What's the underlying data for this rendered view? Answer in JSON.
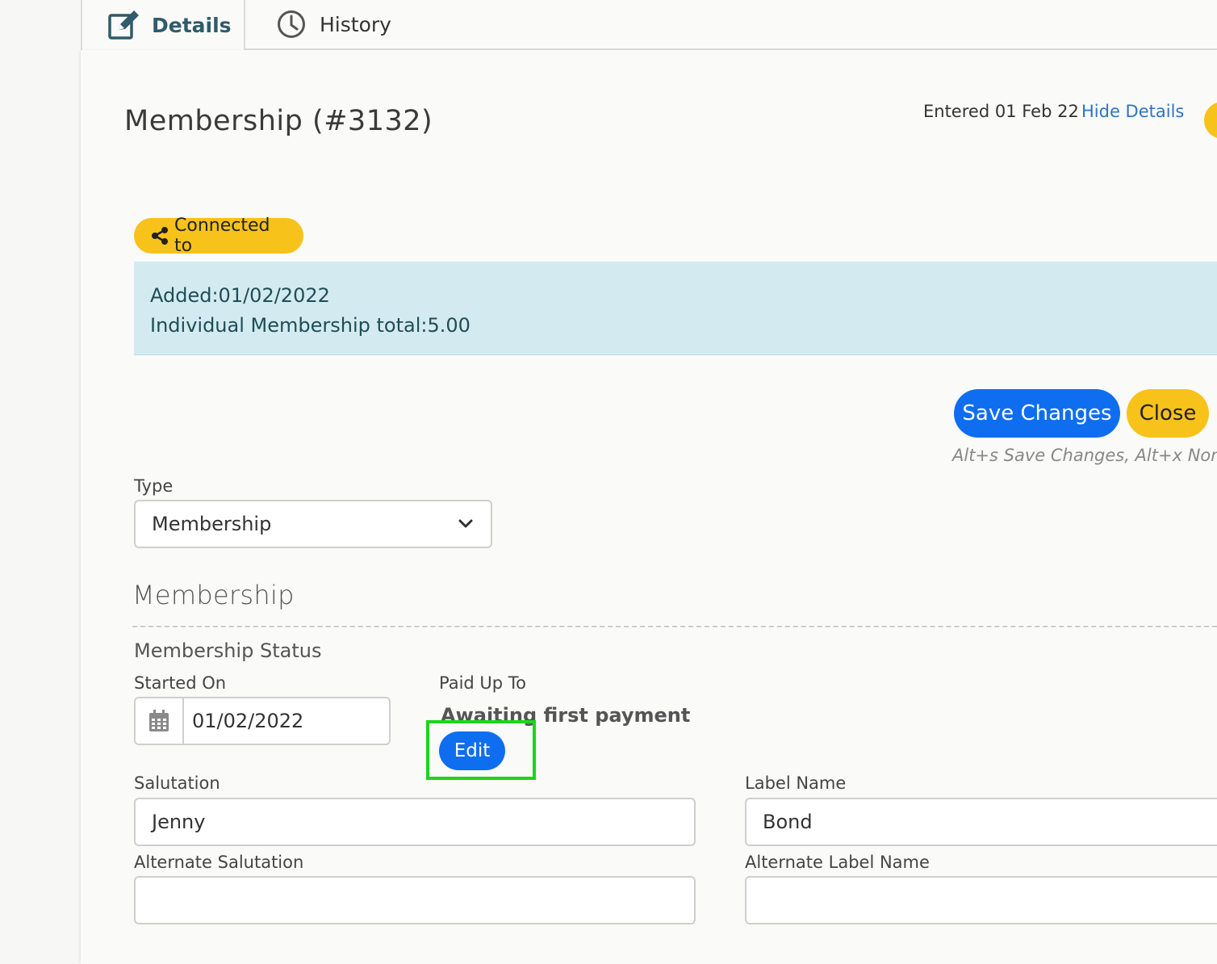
{
  "tabs": {
    "details": {
      "label": "Details",
      "icon": "edit-square-icon"
    },
    "history": {
      "label": "History",
      "icon": "clock-icon"
    }
  },
  "header": {
    "title": "Membership (#3132)",
    "entered": "Entered 01 Feb 22",
    "hide_details": "Hide Details"
  },
  "connected": {
    "label": "Connected to",
    "icon": "share-icon"
  },
  "info": {
    "added": "Added:01/02/2022",
    "total": "Individual Membership total:5.00"
  },
  "actions": {
    "save_label": "Save Changes",
    "close_label": "Close",
    "shortcut_hint": "Alt+s Save Changes, Alt+x None, A"
  },
  "form": {
    "type_label": "Type",
    "type_value": "Membership",
    "section_heading": "Membership",
    "status_heading": "Membership Status",
    "started_on_label": "Started On",
    "started_on_value": "01/02/2022",
    "paid_up_to_label": "Paid Up To",
    "paid_up_to_value": "Awaiting first payment",
    "edit_label": "Edit",
    "salutation_label": "Salutation",
    "salutation_value": "Jenny",
    "label_name_label": "Label Name",
    "label_name_value": "Bond",
    "alt_salutation_label": "Alternate Salutation",
    "alt_salutation_value": "",
    "alt_label_name_label": "Alternate Label Name",
    "alt_label_name_value": ""
  },
  "colors": {
    "primary_blue": "#0f6ef0",
    "accent_yellow": "#f7c21a",
    "info_bg": "#d3ebf0",
    "highlight_green": "#1ed41e",
    "link_blue": "#2e74c0",
    "tab_active_text": "#2f5b6a"
  }
}
